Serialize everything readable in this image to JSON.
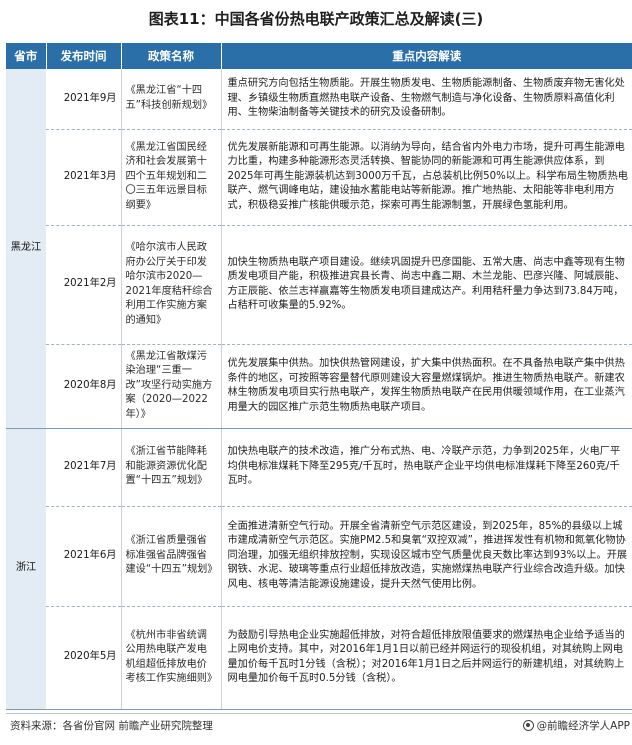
{
  "title": "图表11：中国各省份热电联产政策汇总及解读(三)",
  "table": {
    "headers": [
      "省市",
      "发布时间",
      "政策名称",
      "重点内容解读"
    ],
    "groups": [
      {
        "province": "黑龙江",
        "rows": [
          {
            "date": "2021年9月",
            "name": "《黑龙江省“十四五”科技创新规划》",
            "content": "重点研究方向包括生物质能。开展生物质发电、生物质能源制备、生物质废弃物无害化处理、乡镇级生物质直燃热电联产设备、生物燃气制造与净化设备、生物质原料高值化利用、生物柴油制备等关键技术的研究及设备研制。"
          },
          {
            "date": "2021年3月",
            "name": "《黑龙江省国民经济和社会发展第十四个五年规划和二〇三五年远景目标纲要》",
            "content": "优先发展新能源和可再生能源。以消纳为导向，结合省内外电力市场，提升可再生能源电力比重，构建多种能源形态灵活转换、智能协同的新能源和可再生能源供应体系，到2025年可再生能源装机达到3000万千瓦，占总装机比例50%以上。科学布局生物质热电联产、燃气调峰电站，建设抽水蓄能电站等新能源。推广地热能、太阳能等非电利用方式，积极稳妥推广核能供暖示范，探索可再生能源制氢，开展绿色氢能利用。"
          },
          {
            "date": "2021年2月",
            "name": "《哈尔滨市人民政府办公厅关于印发哈尔滨市2020—2021年度秸秆综合利用工作实施方案的通知》",
            "content": "加快生物质热电联产项目建设。继续巩固提升巴彦国能、五常大唐、尚志中鑫等现有生物质发电项目产能，积极推进宾县长青、尚志中鑫二期、木兰龙能、巴彦兴隆、阿城辰能、方正辰能、依兰志祥赢嘉等生物质发电项目建成达产。利用秸秆量力争达到73.84万吨，占秸秆可收集量的5.92%。"
          },
          {
            "date": "2020年8月",
            "name": "《黑龙江省散煤污染治理“三重一改”攻坚行动实施方案（2020—2022年）》",
            "content": "优先发展集中供热。加快供热管网建设，扩大集中供热面积。在不具备热电联产集中供热条件的地区，可按照等容量替代原则建设大容量燃煤锅炉。推进生物质热电联产。新建农林生物质发电项目实行热电联产，发挥生物质热电联产在民用供暖领域作用，在工业蒸汽用量大的园区推广示范生物质热电联产项目。"
          }
        ]
      },
      {
        "province": "浙江",
        "rows": [
          {
            "date": "2021年7月",
            "name": "《浙江省节能降耗和能源资源优化配置“十四五”规划》",
            "content": "加快热电联产的技术改造，推广分布式热、电、冷联产示范，力争到2025年，火电厂平均供电标准煤耗下降至295克/千瓦时，热电联产企业平均供电标准煤耗下降至260克/千瓦时。"
          },
          {
            "date": "2021年6月",
            "name": "《浙江省质量强省标准强省品牌强省建设“十四五”规划》",
            "content": "全面推进清新空气行动。开展全省清新空气示范区建设，到2025年，85%的县级以上城市建成清新空气示范区。实施PM2.5和臭氧“双控双减”，推进挥发性有机物和氮氧化物协同治理，加强无组织排放控制，实现设区城市空气质量优良天数比率达到93%以上。开展钢铁、水泥、玻璃等重点行业超低排放改造，实施燃煤热电联产行业综合改造升级。加快风电、核电等清洁能源设施建设，提升天然气使用比例。"
          },
          {
            "date": "2020年5月",
            "name": "《杭州市非省统调公用热电联产发电机组超低排放电价考核工作实施细则》",
            "content": "为鼓励引导热电企业实施超低排放，对符合超低排放限值要求的燃煤热电企业给予适当的上网电价支持。其中，对2016年1月1日以前已经并网运行的现役机组，对其统购上网电量加价每千瓦时1分钱（含税）；对2016年1月1日之后并网运行的新建机组，对其统购上网电量加价每千瓦时0.5分钱（含税）。"
          }
        ]
      }
    ]
  },
  "footer": {
    "source": "资料来源：各省份官网 前瞻产业研究院整理",
    "brand": "@前瞻经济学人APP",
    "brand_icon": "qianzhan-logo-icon"
  }
}
